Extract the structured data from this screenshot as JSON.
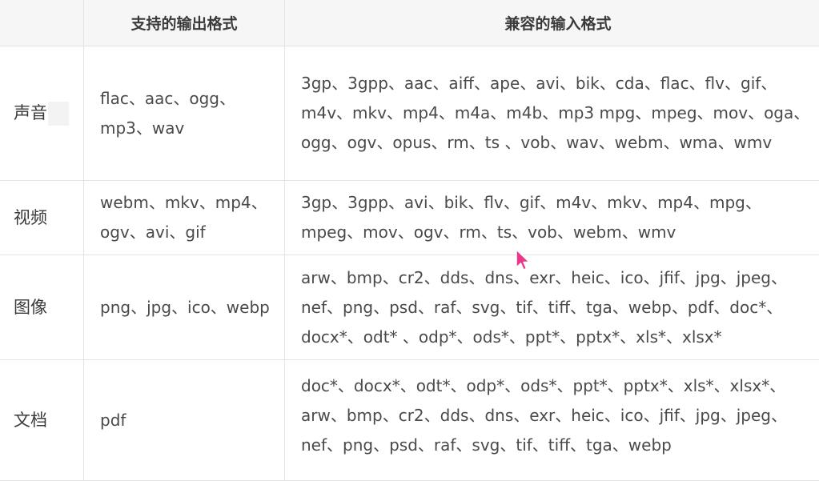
{
  "table": {
    "headers": {
      "category": "",
      "output": "支持的输出格式",
      "input": "兼容的输入格式"
    },
    "rows": [
      {
        "category": "声音",
        "output": "flac、aac、ogg、mp3、wav",
        "input": "3gp、3gpp、aac、aiff、ape、avi、bik、cda、flac、flv、gif、m4v、mkv、mp4、m4a、m4b、mp3 mpg、mpeg、mov、oga、ogg、ogv、opus、rm、ts 、vob、wav、webm、wma、wmv"
      },
      {
        "category": "视频",
        "output": "webm、mkv、mp4、ogv、avi、gif",
        "input": "3gp、3gpp、avi、bik、flv、gif、m4v、mkv、mp4、mpg、mpeg、mov、ogv、rm、ts、vob、webm、wmv"
      },
      {
        "category": "图像",
        "output": "png、jpg、ico、webp",
        "input": "arw、bmp、cr2、dds、dns、exr、heic、ico、jfif、jpg、jpeg、nef、png、psd、raf、svg、tif、tiff、tga、webp、pdf、doc*、docx*、odt* 、odp*、ods*、ppt*、pptx*、xls*、xlsx*"
      },
      {
        "category": "文档",
        "output": "pdf",
        "input": "doc*、docx*、odt*、odp*、ods*、ppt*、pptx*、xls*、xlsx*、arw、bmp、cr2、dds、dns、exr、heic、ico、jfif、jpg、jpeg、nef、png、psd、raf、svg、tif、tiff、tga、webp"
      }
    ]
  },
  "colors": {
    "header_bg": "#f6f6f6",
    "border": "#e3e3e3",
    "text": "#4a4a4a",
    "cursor": "#e8388a"
  }
}
